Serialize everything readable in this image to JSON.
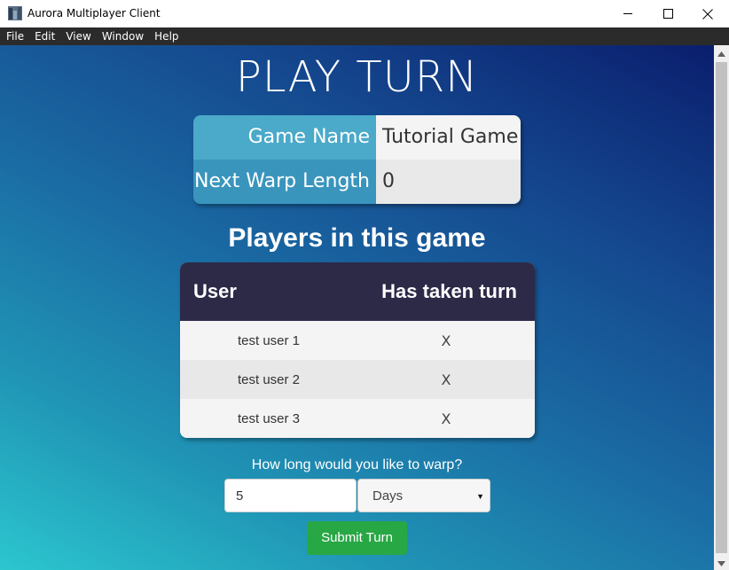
{
  "window": {
    "title": "Aurora Multiplayer Client",
    "icons": {
      "app": "app-icon",
      "minimize": "minimize-icon",
      "maximize": "maximize-icon",
      "close": "close-icon"
    }
  },
  "menu": [
    "File",
    "Edit",
    "View",
    "Window",
    "Help"
  ],
  "page": {
    "title": "PLAY TURN",
    "info": [
      {
        "label": "Game Name",
        "value": "Tutorial Game"
      },
      {
        "label": "Next Warp Length",
        "value": "0"
      }
    ],
    "players_heading": "Players in this game",
    "players_table": {
      "headers": {
        "user": "User",
        "turn": "Has taken turn"
      },
      "rows": [
        {
          "user": "test user 1",
          "taken": "X"
        },
        {
          "user": "test user 2",
          "taken": "X"
        },
        {
          "user": "test user 3",
          "taken": "X"
        }
      ]
    },
    "warp": {
      "question": "How long would you like to warp?",
      "amount": "5",
      "unit": "Days"
    },
    "submit_label": "Submit Turn"
  },
  "colors": {
    "table_header": "#2d2a48",
    "info_label": "#4ba9c9",
    "submit": "#28a745"
  }
}
